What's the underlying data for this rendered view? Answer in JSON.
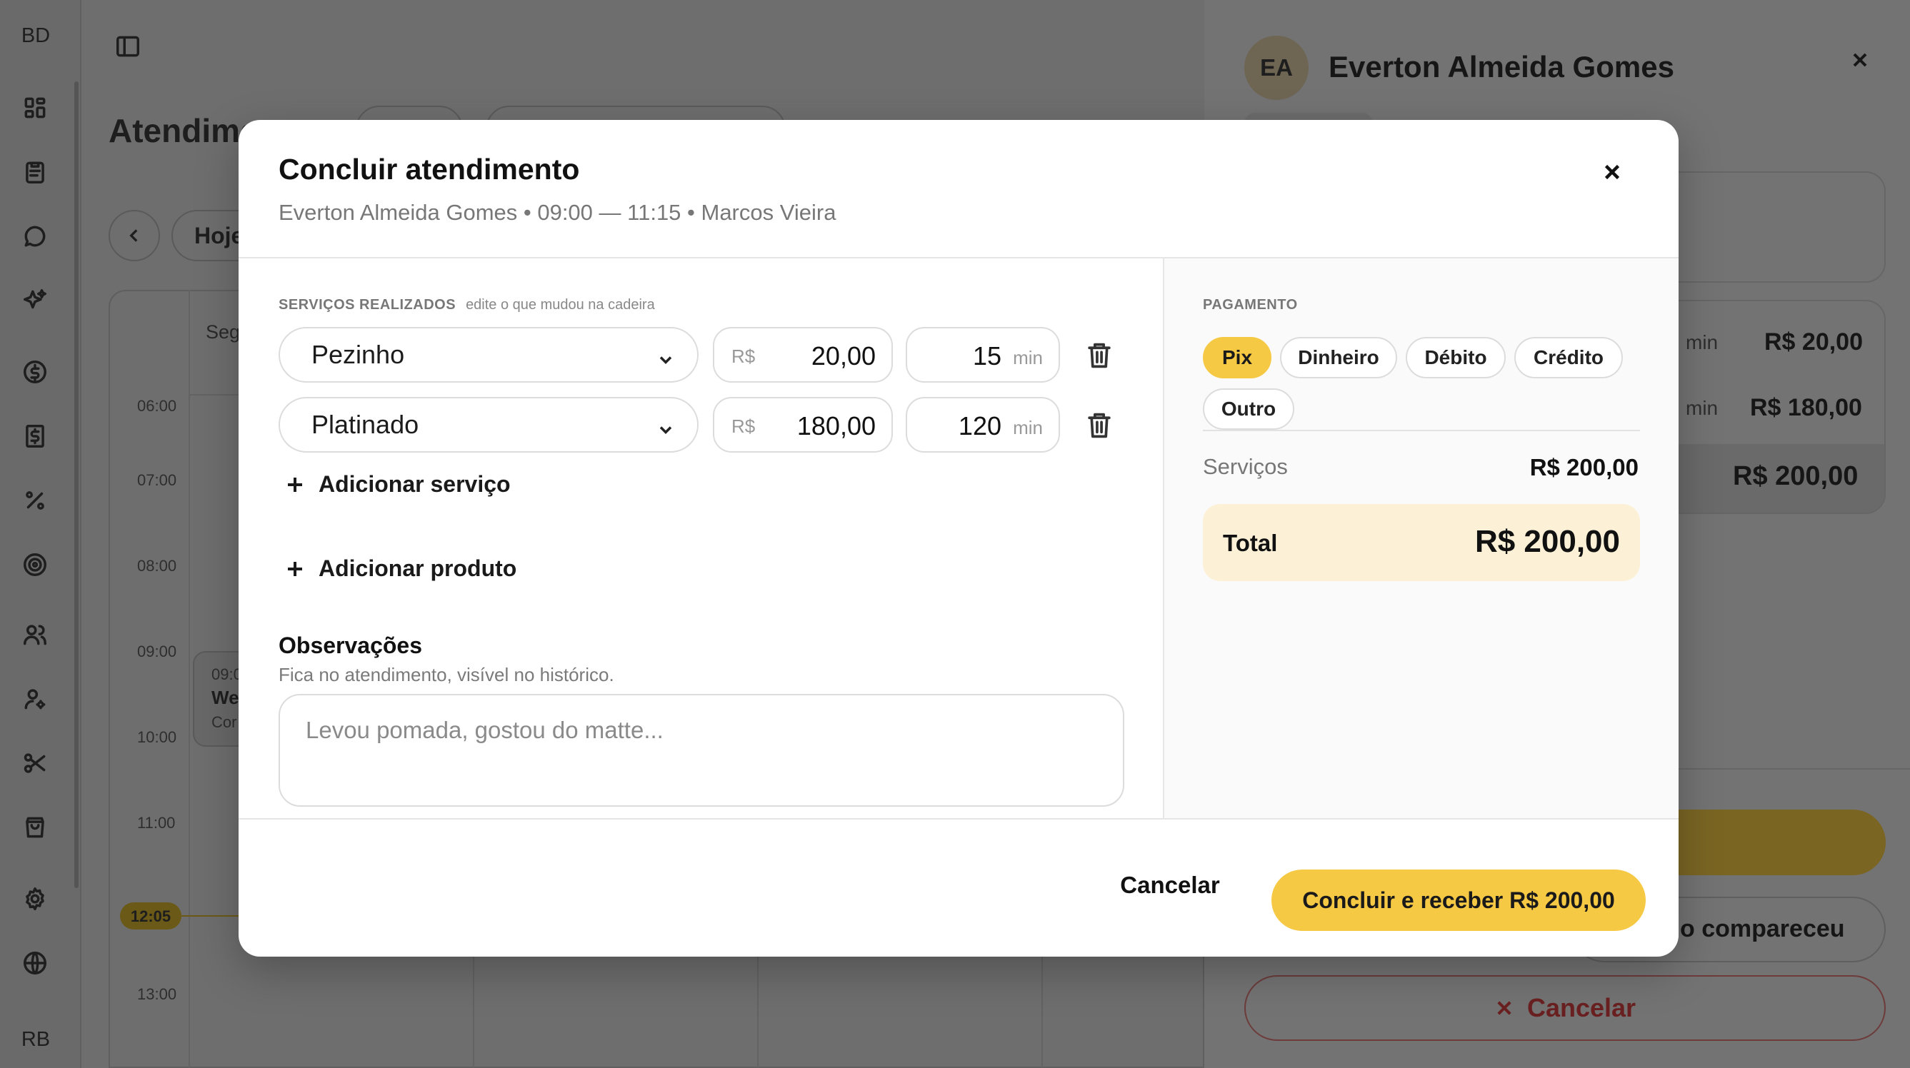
{
  "rail": {
    "top_initials": "BD",
    "bottom_initials": "RB",
    "icons": [
      "dashboard-icon",
      "clipboard-icon",
      "chat-icon",
      "sparkles-icon",
      "dollar-circle-icon",
      "dollar-receipt-icon",
      "percent-icon",
      "target-icon",
      "users-icon",
      "user-settings-icon",
      "scissors-icon",
      "shopping-bag-icon",
      "gear-icon",
      "globe-icon"
    ]
  },
  "background": {
    "page_title": "Atendime",
    "today_button": "Hoje",
    "day_header": "Seg",
    "hours": [
      "06:00",
      "07:00",
      "08:00",
      "09:00",
      "10:00",
      "11:00",
      "12:05",
      "13:00"
    ],
    "event": {
      "time": "09:0",
      "name": "We",
      "service": "Cor"
    }
  },
  "drawer": {
    "avatar_initials": "EA",
    "client_name": "Everton Almeida Gomes",
    "rows": [
      {
        "min": "min",
        "price": "R$ 20,00"
      },
      {
        "min": "min",
        "price": "R$ 180,00"
      }
    ],
    "total_price": "R$ 200,00",
    "no_show_label": "o compareceu",
    "cancel_label": "Cancelar"
  },
  "modal": {
    "title": "Concluir atendimento",
    "subtitle": "Everton Almeida Gomes • 09:00 — 11:15 • Marcos Vieira",
    "services_label": "SERVIÇOS REALIZADOS",
    "services_hint": "edite o que mudou na cadeira",
    "services": [
      {
        "name": "Pezinho",
        "currency": "R$",
        "price": "20,00",
        "minutes": "15",
        "unit": "min"
      },
      {
        "name": "Platinado",
        "currency": "R$",
        "price": "180,00",
        "minutes": "120",
        "unit": "min"
      }
    ],
    "add_service": "Adicionar serviço",
    "add_product": "Adicionar produto",
    "notes_label": "Observações",
    "notes_hint": "Fica no atendimento, visível no histórico.",
    "notes_placeholder": "Levou pomada, gostou do matte...",
    "payment_label": "PAGAMENTO",
    "payment_methods": [
      "Pix",
      "Dinheiro",
      "Débito",
      "Crédito",
      "Outro"
    ],
    "payment_selected": "Pix",
    "subtotal_label": "Serviços",
    "subtotal_value": "R$ 200,00",
    "total_label": "Total",
    "total_value": "R$ 200,00",
    "cancel_button": "Cancelar",
    "confirm_button": "Concluir e receber R$ 200,00"
  },
  "colors": {
    "accent": "#f6c945",
    "total_bg": "#fcf1d6",
    "danger": "#c23b3b"
  }
}
